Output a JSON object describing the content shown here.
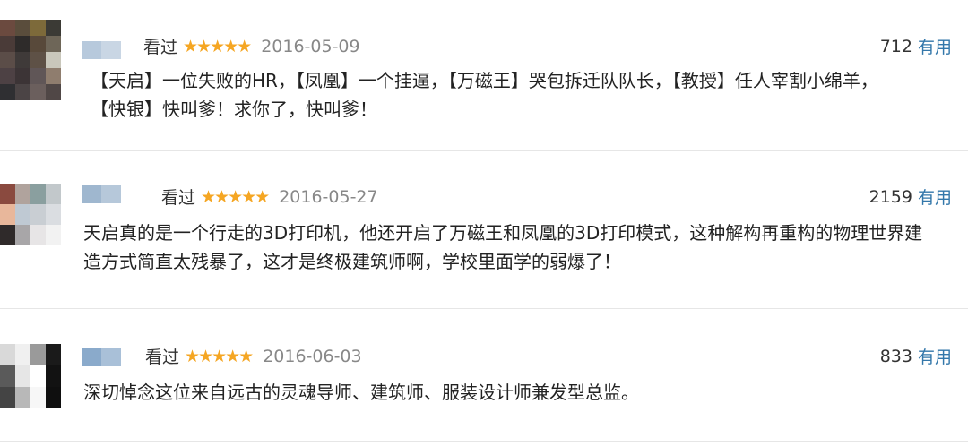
{
  "reviews": [
    {
      "watched": "看过",
      "stars": "★★★★★",
      "date": "2016-05-09",
      "votes": "712",
      "useful": "有用",
      "lines": [
        "【天启】一位失败的HR，【凤凰】一个挂逼，【万磁王】哭包拆迁队队长，【教授】任人宰割小绵羊，",
        "【快银】快叫爹！求你了，快叫爹！"
      ]
    },
    {
      "watched": "看过",
      "stars": "★★★★★",
      "date": "2016-05-27",
      "votes": "2159",
      "useful": "有用",
      "lines": [
        "天启真的是一个行走的3D打印机，他还开启了万磁王和凤凰的3D打印模式，这种解构再重构的物理世界建",
        "造方式简直太残暴了，这才是终极建筑师啊，学校里面学的弱爆了！"
      ]
    },
    {
      "watched": "看过",
      "stars": "★★★★★",
      "date": "2016-06-03",
      "votes": "833",
      "useful": "有用",
      "lines": [
        "深切悼念这位来自远古的灵魂导师、建筑师、服装设计师兼发型总监。"
      ]
    }
  ],
  "colors": {
    "star": "#f5a623",
    "link": "#3377aa",
    "date": "#888888",
    "divider": "#e6e6e6"
  }
}
